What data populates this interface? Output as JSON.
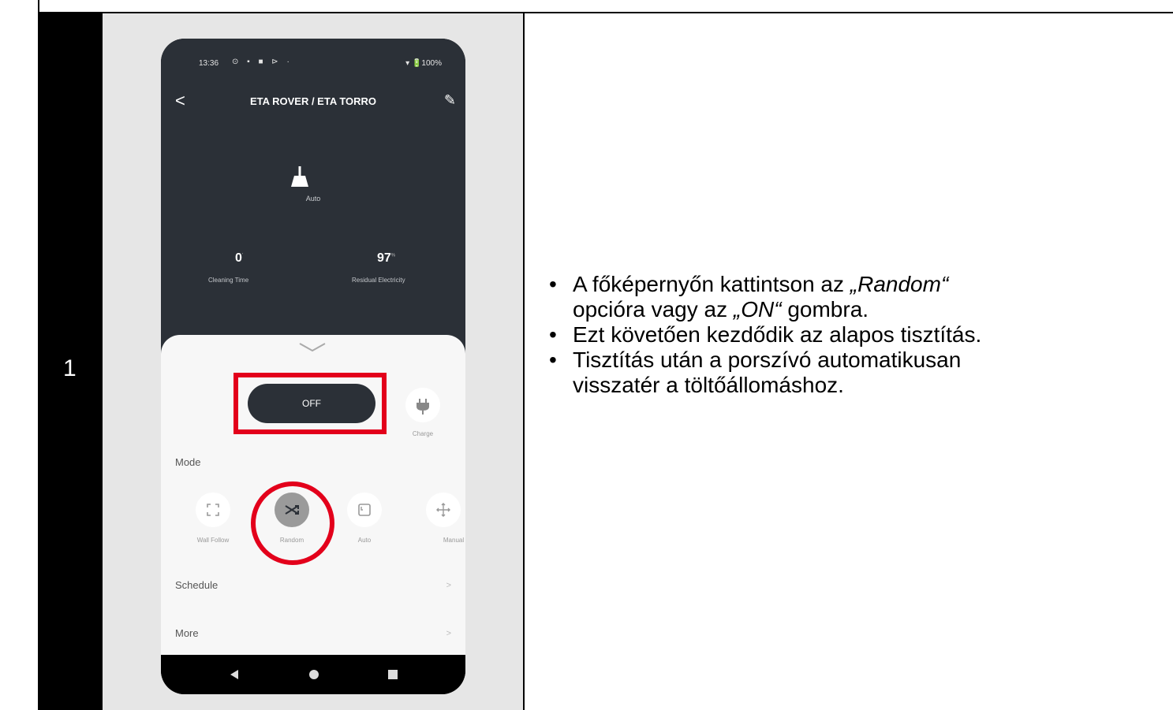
{
  "step": {
    "number": "1"
  },
  "phone": {
    "status": {
      "time": "13:36",
      "icons": "⊙ ▪ ■ ⊳ ·",
      "battery": "▾ 🔋100%"
    },
    "header": {
      "back_icon": "<",
      "title": "ETA ROVER / ETA TORRO",
      "edit_icon": "✎"
    },
    "current_mode": {
      "icon": "broom-icon",
      "label": "Auto"
    },
    "stats": [
      {
        "value": "0",
        "unit": "'",
        "label": "Cleaning Time"
      },
      {
        "value": "97",
        "unit": "%",
        "label": "Residual Electricity"
      }
    ],
    "controls": {
      "power_label": "OFF",
      "charge_label": "Charge"
    },
    "mode_section_label": "Mode",
    "modes": [
      {
        "label": "Wall Follow",
        "icon": "wall-follow-icon"
      },
      {
        "label": "Random",
        "icon": "random-icon"
      },
      {
        "label": "Auto",
        "icon": "auto-icon"
      },
      {
        "label": "Manual",
        "icon": "manual-icon"
      }
    ],
    "rows": [
      {
        "label": "Schedule",
        "arrow": ">"
      },
      {
        "label": "More",
        "arrow": ">"
      }
    ],
    "nav": {
      "back": "◀",
      "home": "●",
      "recents": "■"
    }
  },
  "instructions": {
    "bullet1_line1_prefix": "A főképernyőn kattintson az ",
    "bullet1_line1_italic": "„Random“",
    "bullet1_line2_prefix": "opcióra vagy az ",
    "bullet1_line2_italic": "„ON“",
    "bullet1_line2_suffix": " gombra.",
    "bullet2": "Ezt követően kezdődik az alapos tisztítás.",
    "bullet3_line1": "Tisztítás után a porszívó automatikusan",
    "bullet3_line2": "visszatér a töltőállomáshoz."
  },
  "colors": {
    "highlight": "#e3001b",
    "app_dark": "#2b3037"
  }
}
